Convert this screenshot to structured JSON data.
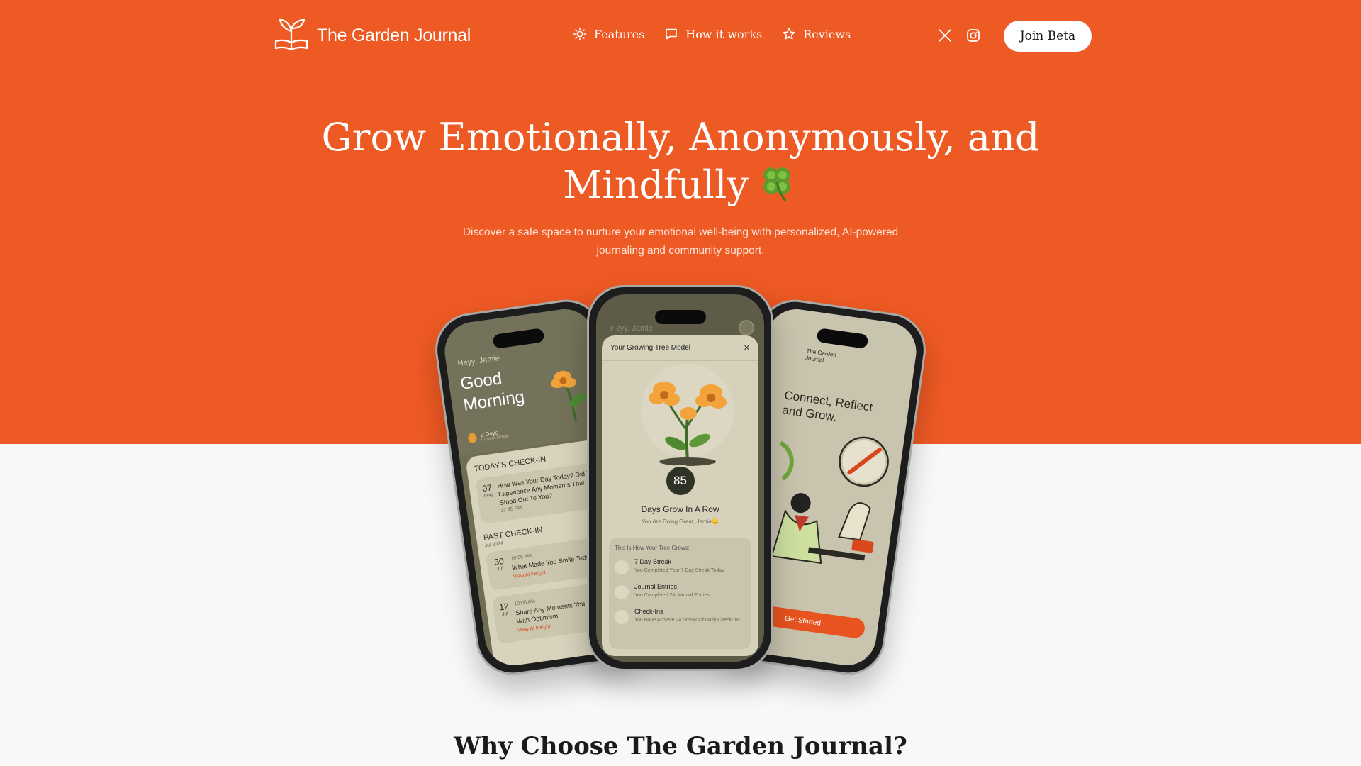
{
  "brand": {
    "name": "The Garden Journal"
  },
  "nav": {
    "links": [
      {
        "label": "Features",
        "icon": "sun-icon"
      },
      {
        "label": "How it works",
        "icon": "chat-bubble-icon"
      },
      {
        "label": "Reviews",
        "icon": "star-icon"
      }
    ],
    "social": [
      "x-logo-icon",
      "instagram-icon"
    ],
    "cta": "Join Beta"
  },
  "hero": {
    "headline_line1": "Grow Emotionally, Anonymously, and",
    "headline_line2": "Mindfully",
    "subtitle": "Discover a safe space to nurture your emotional well-being with personalized, AI-powered journaling and community support."
  },
  "phone_left": {
    "greeting_small": "Heyy, Jamie",
    "greeting": "Good Morning",
    "streak": "2 Days",
    "streak_label": "Current Streak",
    "today_title": "TODAY'S CHECK-IN",
    "today_item": {
      "day": "07",
      "month": "Aug",
      "text": "How Was Your Day Today? Did You Experience Any Moments That Stood Out To You?",
      "time": "12:45 PM"
    },
    "past_title": "PAST CHECK-IN",
    "past_month": "Jul 2024",
    "past_items": [
      {
        "day": "30",
        "month": "Jul",
        "time": "10:05 AM",
        "text": "What Made You Smile Today?",
        "link": "View AI Insight"
      },
      {
        "day": "12",
        "month": "Jul",
        "time": "10:05 AM",
        "text": "Share Any Moments You Faced With Optimism",
        "link": "View AI Insight"
      }
    ]
  },
  "phone_center": {
    "bg_greeting": "Heyy, Jamie",
    "modal_title": "Your Growing Tree Model",
    "score": "85",
    "days_title": "Days Grow In A Row",
    "days_sub": "You Are Doing Great, Jamie😊",
    "grow_title": "This Is How Your Tree Grows:",
    "grow_items": [
      {
        "name": "7 Day Streak",
        "desc": "You Completed Your 7 Day Streak Today."
      },
      {
        "name": "Journal Entries",
        "desc": "You Completed 24 Journal Entries."
      },
      {
        "name": "Check-Ins",
        "desc": "You Have Achieve 24 Streak Of Daily Check-Ins."
      }
    ]
  },
  "phone_right": {
    "brand": "The Garden Journal",
    "headline": "Connect, Reflect and Grow.",
    "cta": "Get Started"
  },
  "section": {
    "title": "Why Choose The Garden Journal?"
  },
  "colors": {
    "brand_orange": "#ee5a24",
    "page_bg": "#f8f8f8"
  }
}
